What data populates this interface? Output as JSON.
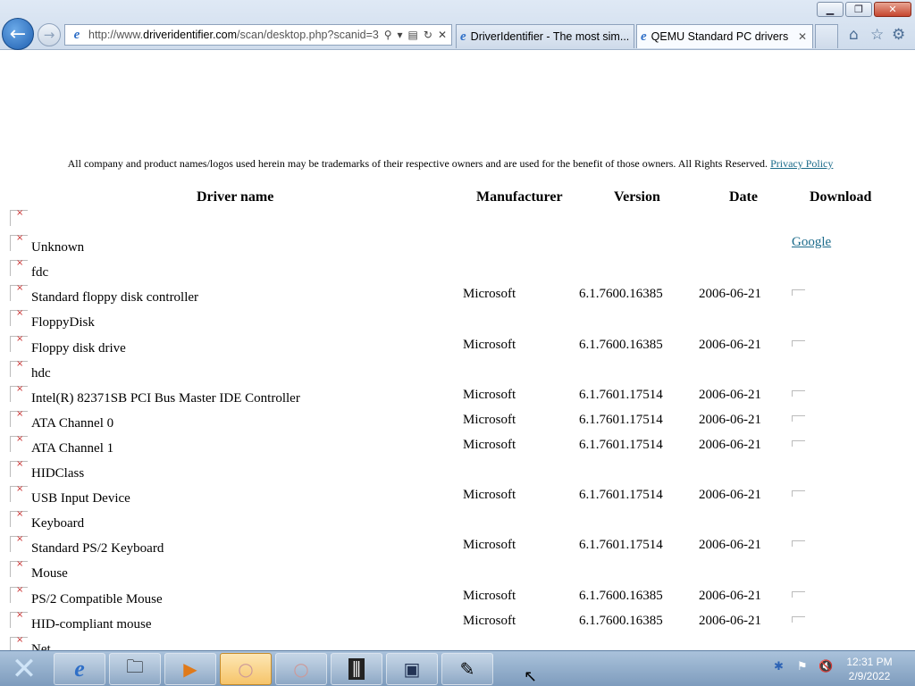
{
  "browser": {
    "url_prefix": "http://www.",
    "url_domain": "driveridentifier.com",
    "url_path": "/scan/desktop.php?scanid=3",
    "tabs": [
      {
        "label": "DriverIdentifier - The most sim..."
      },
      {
        "label": "QEMU Standard PC drivers"
      }
    ]
  },
  "page": {
    "notice": "All company and product names/logos used herein may be trademarks of their respective owners and are used for the benefit of those owners. All Rights Reserved.",
    "privacy_link": "Privacy Policy",
    "headers": {
      "name": "Driver name",
      "manufacturer": "Manufacturer",
      "version": "Version",
      "date": "Date",
      "download": "Download"
    },
    "rows": [
      {
        "name": "",
        "manufacturer": "",
        "version": "",
        "date": "",
        "download": ""
      },
      {
        "name": "Unknown",
        "manufacturer": "",
        "version": "",
        "date": "",
        "download": "Google"
      },
      {
        "name": "fdc",
        "manufacturer": "",
        "version": "",
        "date": "",
        "download": ""
      },
      {
        "name": "Standard floppy disk controller",
        "manufacturer": "Microsoft",
        "version": "6.1.7600.16385",
        "date": "2006-06-21",
        "download": ""
      },
      {
        "name": "FloppyDisk",
        "manufacturer": "",
        "version": "",
        "date": "",
        "download": ""
      },
      {
        "name": "Floppy disk drive",
        "manufacturer": "Microsoft",
        "version": "6.1.7600.16385",
        "date": "2006-06-21",
        "download": ""
      },
      {
        "name": "hdc",
        "manufacturer": "",
        "version": "",
        "date": "",
        "download": ""
      },
      {
        "name": "Intel(R) 82371SB PCI Bus Master IDE Controller",
        "manufacturer": "Microsoft",
        "version": "6.1.7601.17514",
        "date": "2006-06-21",
        "download": ""
      },
      {
        "name": "ATA Channel 0",
        "manufacturer": "Microsoft",
        "version": "6.1.7601.17514",
        "date": "2006-06-21",
        "download": ""
      },
      {
        "name": "ATA Channel 1",
        "manufacturer": "Microsoft",
        "version": "6.1.7601.17514",
        "date": "2006-06-21",
        "download": ""
      },
      {
        "name": "HIDClass",
        "manufacturer": "",
        "version": "",
        "date": "",
        "download": ""
      },
      {
        "name": "USB Input Device",
        "manufacturer": "Microsoft",
        "version": "6.1.7601.17514",
        "date": "2006-06-21",
        "download": ""
      },
      {
        "name": "Keyboard",
        "manufacturer": "",
        "version": "",
        "date": "",
        "download": ""
      },
      {
        "name": "Standard PS/2 Keyboard",
        "manufacturer": "Microsoft",
        "version": "6.1.7601.17514",
        "date": "2006-06-21",
        "download": ""
      },
      {
        "name": "Mouse",
        "manufacturer": "",
        "version": "",
        "date": "",
        "download": ""
      },
      {
        "name": "PS/2 Compatible Mouse",
        "manufacturer": "Microsoft",
        "version": "6.1.7600.16385",
        "date": "2006-06-21",
        "download": ""
      },
      {
        "name": "HID-compliant mouse",
        "manufacturer": "Microsoft",
        "version": "6.1.7600.16385",
        "date": "2006-06-21",
        "download": ""
      },
      {
        "name": "Net",
        "manufacturer": "",
        "version": "",
        "date": "",
        "download": ""
      }
    ]
  },
  "taskbar": {
    "time": "12:31 PM",
    "date": "2/9/2022"
  }
}
